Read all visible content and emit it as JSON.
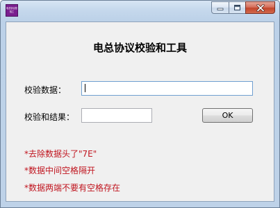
{
  "window": {
    "app_icon_text": "电总协议校验工"
  },
  "main": {
    "heading": "电总协议校验和工具",
    "data_label": "校验数据：",
    "data_value": "",
    "result_label": "校验和结果：",
    "result_value": "",
    "ok_label": "OK"
  },
  "notes": [
    "*去除数据头了\"7E\"",
    "*数据中间空格隔开",
    "*数据两端不要有空格存在"
  ],
  "colors": {
    "note_text": "#c0141e",
    "title_bar": "#c5d8ec",
    "close_button": "#c3452c"
  },
  "icons": {
    "minimize": "minimize-icon",
    "maximize": "maximize-icon",
    "close": "close-icon"
  }
}
